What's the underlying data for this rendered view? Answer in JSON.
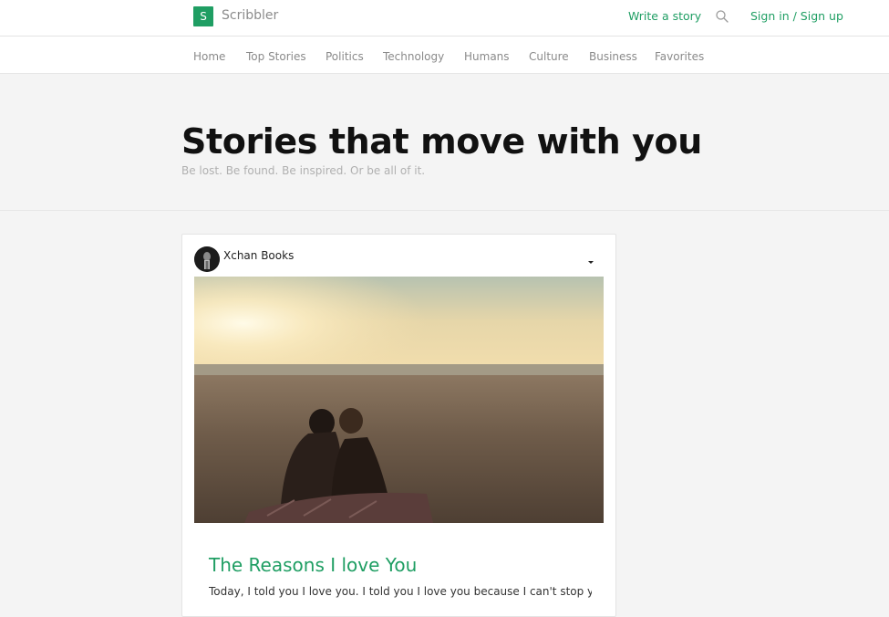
{
  "header": {
    "logo_letter": "S",
    "brand": "Scribbler",
    "write_label": "Write a story",
    "signin_label": "Sign in / Sign up",
    "search_icon": "search-icon",
    "accent_color": "#1f9e63"
  },
  "nav": {
    "items": [
      {
        "label": "Home"
      },
      {
        "label": "Top Stories"
      },
      {
        "label": "Politics"
      },
      {
        "label": "Technology"
      },
      {
        "label": "Humans"
      },
      {
        "label": "Culture"
      },
      {
        "label": "Business"
      },
      {
        "label": "Favorites"
      }
    ]
  },
  "hero": {
    "title": "Stories that move with you",
    "subtitle": "Be lost. Be found. Be inspired. Or be all of it."
  },
  "feed": {
    "cards": [
      {
        "author": "Xchan Books",
        "menu_icon": "caret-down-icon",
        "title": "The Reasons I love You",
        "excerpt": "Today, I told you I love you. I told you I love you because I can't stop you"
      }
    ]
  }
}
